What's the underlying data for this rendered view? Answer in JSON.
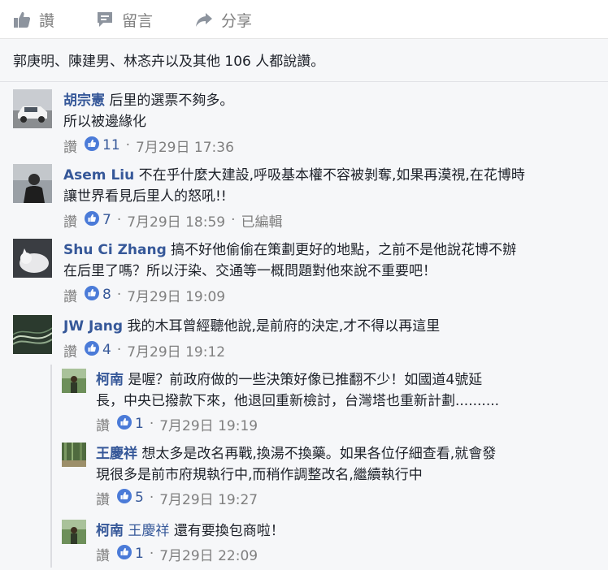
{
  "actions": {
    "like": "讚",
    "comment": "留言",
    "share": "分享"
  },
  "likes_summary": "郭庚明、陳建男、林忞卉以及其他 106 人都說讚。",
  "comments": [
    {
      "author": "胡宗憲",
      "line1": "后里的選票不夠多。",
      "line2": "所以被邊緣化",
      "like_label": "讚",
      "reactions": "11",
      "date": "7月29日 17:36"
    },
    {
      "author": "Asem Liu",
      "line1": "不在乎什麼大建設,呼吸基本權不容被剝奪,如果再漠視,在花博時",
      "line2": "讓世界看見后里人的怒吼!!",
      "like_label": "讚",
      "reactions": "7",
      "date": "7月29日 18:59",
      "edited": "已編輯"
    },
    {
      "author": "Shu Ci Zhang",
      "line1": "搞不好他偷偷在策劃更好的地點，之前不是他說花博不辦",
      "line2": "在后里了嗎？所以汙染、交通等一概問題對他來說不重要吧！",
      "like_label": "讚",
      "reactions": "8",
      "date": "7月29日 19:09"
    },
    {
      "author": "JW Jang",
      "line1": "我的木耳曾經聽他說,是前府的決定,才不得以再這里",
      "like_label": "讚",
      "reactions": "4",
      "date": "7月29日 19:12"
    }
  ],
  "replies": [
    {
      "author": "柯南",
      "line1": "是喔？前政府做的一些決策好像已推翻不少！如國道4號延",
      "line2": "長，中央已撥款下來，他退回重新檢討，台灣塔也重新計劃..........",
      "like_label": "讚",
      "reactions": "1",
      "date": "7月29日 19:19"
    },
    {
      "author": "王慶祥",
      "line1": "想太多是改名再戰,換湯不換藥。如果各位仔細查看,就會發",
      "line2": "現很多是前市府規執行中,而稍作調整改名,繼續執行中",
      "like_label": "讚",
      "reactions": "5",
      "date": "7月29日 19:27"
    },
    {
      "author": "柯南",
      "mention": "王慶祥",
      "line1": "還有要換包商啦！",
      "like_label": "讚",
      "reactions": "1",
      "date": "7月29日 22:09"
    }
  ],
  "colors": {
    "link": "#365899",
    "meta": "#7f7f7f",
    "reaction_blue": "#4b7bd8",
    "background": "#f6f7f9"
  },
  "icons": {
    "like": "thumbs-up-icon",
    "comment": "speech-bubble-icon",
    "share": "share-arrow-icon",
    "reaction": "like-reaction-icon"
  }
}
